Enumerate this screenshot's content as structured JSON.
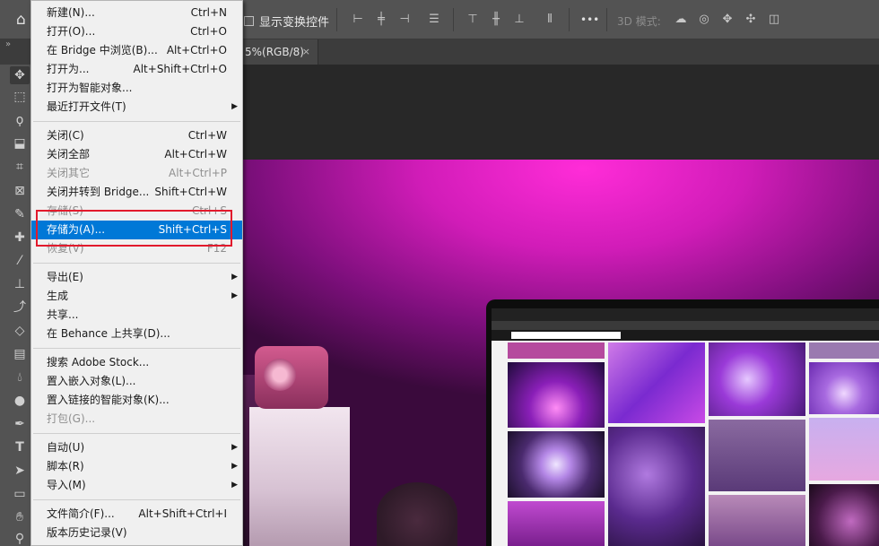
{
  "options_bar": {
    "show_transform_label": "显示变换控件",
    "mode_3d_label": "3D 模式:",
    "more_label": "•••"
  },
  "tabs": {
    "collapse_glyph": "»",
    "doc_tab_label": "5%(RGB/8)",
    "close_glyph": "×"
  },
  "file_menu": {
    "items": [
      {
        "label": "新建(N)...",
        "shortcut": "Ctrl+N"
      },
      {
        "label": "打开(O)...",
        "shortcut": "Ctrl+O"
      },
      {
        "label": "在 Bridge 中浏览(B)...",
        "shortcut": "Alt+Ctrl+O"
      },
      {
        "label": "打开为...",
        "shortcut": "Alt+Shift+Ctrl+O"
      },
      {
        "label": "打开为智能对象...",
        "shortcut": ""
      },
      {
        "label": "最近打开文件(T)",
        "shortcut": ""
      },
      {
        "label": "关闭(C)",
        "shortcut": "Ctrl+W"
      },
      {
        "label": "关闭全部",
        "shortcut": "Alt+Ctrl+W"
      },
      {
        "label": "关闭其它",
        "shortcut": "Alt+Ctrl+P"
      },
      {
        "label": "关闭并转到 Bridge...",
        "shortcut": "Shift+Ctrl+W"
      },
      {
        "label": "存储(S)",
        "shortcut": "Ctrl+S"
      },
      {
        "label": "存储为(A)...",
        "shortcut": "Shift+Ctrl+S"
      },
      {
        "label": "恢复(V)",
        "shortcut": "F12"
      },
      {
        "label": "导出(E)",
        "shortcut": ""
      },
      {
        "label": "生成",
        "shortcut": ""
      },
      {
        "label": "共享...",
        "shortcut": ""
      },
      {
        "label": "在 Behance 上共享(D)...",
        "shortcut": ""
      },
      {
        "label": "搜索 Adobe Stock...",
        "shortcut": ""
      },
      {
        "label": "置入嵌入对象(L)...",
        "shortcut": ""
      },
      {
        "label": "置入链接的智能对象(K)...",
        "shortcut": ""
      },
      {
        "label": "打包(G)...",
        "shortcut": ""
      },
      {
        "label": "自动(U)",
        "shortcut": ""
      },
      {
        "label": "脚本(R)",
        "shortcut": ""
      },
      {
        "label": "导入(M)",
        "shortcut": ""
      },
      {
        "label": "文件简介(F)...",
        "shortcut": "Alt+Shift+Ctrl+I"
      },
      {
        "label": "版本历史记录(V)",
        "shortcut": ""
      }
    ]
  },
  "colors": {
    "menu_highlight": "#0078d7",
    "annotation_box": "#e21a2c",
    "panel_bg": "#535353",
    "canvas_bg": "#282828"
  },
  "icons": {
    "home": "home-icon",
    "submenu": "submenu-arrow-icon",
    "tools": [
      "move-icon",
      "marquee-icon",
      "lasso-icon",
      "quick-select-icon",
      "crop-icon",
      "frame-icon",
      "eyedropper-icon",
      "healing-icon",
      "brush-icon",
      "stamp-icon",
      "history-brush-icon",
      "eraser-icon",
      "gradient-icon",
      "blur-icon",
      "dodge-icon",
      "pen-icon",
      "type-icon",
      "path-select-icon",
      "rectangle-icon",
      "hand-icon",
      "zoom-icon"
    ]
  }
}
